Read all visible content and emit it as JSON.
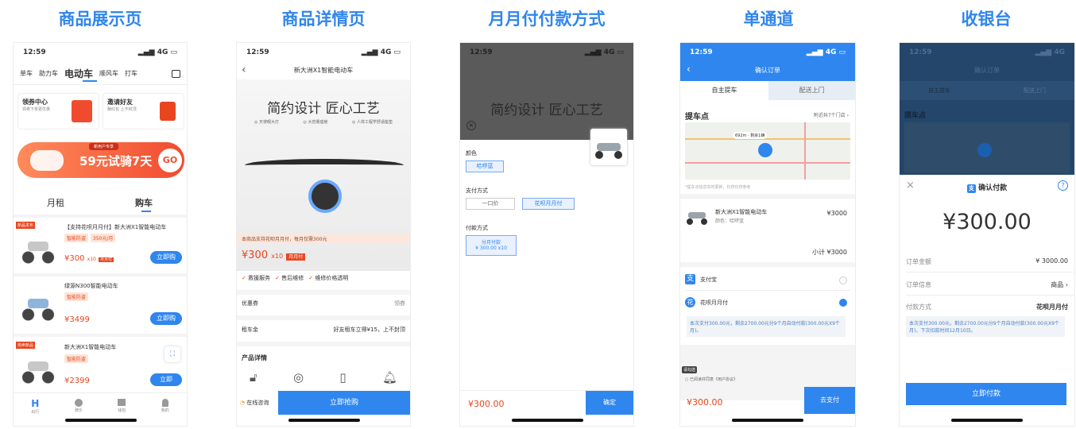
{
  "titles": [
    "商品展示页",
    "商品详情页",
    "月月付付款方式",
    "单通道",
    "收银台"
  ],
  "status": {
    "time": "12:59",
    "net": "4G"
  },
  "p1": {
    "tabs": [
      "单车",
      "助力车",
      "电动车",
      "顺风车",
      "打车"
    ],
    "cards": [
      {
        "title": "领券中心",
        "sub": "领券下单更优惠"
      },
      {
        "title": "邀请好友",
        "sub": "赚红包 上不封顶"
      }
    ],
    "banner": {
      "tag": "新用户专享",
      "text": "59元试骑7天",
      "go": "GO"
    },
    "subtabs": [
      "月租",
      "购车"
    ],
    "products": [
      {
        "badge": "新品发布",
        "name": "【支持花呗月月付】新大洲X1智能电动车",
        "tags": [
          "智能防盗",
          "350元/月"
        ],
        "price": "¥300",
        "suffix": "x10",
        "plan": "月月付",
        "btn": "立即购"
      },
      {
        "badge": "",
        "name": "绿源N300智能电动车",
        "tags": [
          "智能防盗"
        ],
        "price": "¥3499",
        "suffix": "",
        "plan": "",
        "btn": "立即购"
      },
      {
        "badge": "热卖新品",
        "name": "新大洲X1智能电动车",
        "tags": [
          "智能防盗"
        ],
        "price": "¥2399",
        "suffix": "",
        "plan": "",
        "btn": "立即"
      }
    ],
    "nav": [
      "出行",
      "骑乐",
      "钱包",
      "我的"
    ]
  },
  "p2": {
    "title": "新大洲X1智能电动车",
    "hero": "简约设计 匠心工艺",
    "features": [
      "天使眼大灯",
      "大容量座舱",
      "人体工程学舒适座垫"
    ],
    "promo": "本商品支持花呗月月付，每月仅需300元",
    "price": "¥300",
    "suffix": "x10",
    "plan": "月月付",
    "services": [
      "救援服务",
      "售后维修",
      "维修价格透明"
    ],
    "coupon_label": "优惠券",
    "coupon_val": "领券",
    "rent_label": "租车金",
    "rent_val": "好友租车立得¥15，上不封顶",
    "detail": "产品详情",
    "consult": "在线咨询",
    "buy": "立即抢购"
  },
  "p3": {
    "color_label": "颜色",
    "color": "哈啰蓝",
    "pay_label": "支付方式",
    "pay_opts": [
      "一口价",
      "花呗月月付"
    ],
    "plan_label": "付款方式",
    "plan_l1": "分月付款",
    "plan_l2": "¥ 300.00 x10",
    "total": "¥300.00",
    "confirm": "确定"
  },
  "p4": {
    "title": "确认订单",
    "tabs": [
      "自主提车",
      "配送上门"
    ],
    "pickup": "提车点",
    "nearby": "附近共7个门店",
    "map_label": "692m · 剩余1辆",
    "map_note": "*提车点信息实时更新，仅供仅供参考",
    "item": "新大洲X1智能电动车",
    "item_color": "颜色：哈啰蓝",
    "item_price": "¥3000",
    "subtotal": "小计 ¥3000",
    "alipay": "支付宝",
    "huabei": "花呗月月付",
    "note": "本次支付300.00元，剩余2700.00元分9个月自动付款(300.00元X9个月)。",
    "check_tip": "请勾选",
    "agree": "已阅读并同意《用户协议》",
    "total": "¥300.00",
    "pay": "去支付"
  },
  "p5": {
    "title": "确认付款",
    "amount": "¥300.00",
    "rows": [
      {
        "k": "订单金额",
        "v": "¥ 3000.00"
      },
      {
        "k": "订单信息",
        "v": "商品"
      },
      {
        "k": "付款方式",
        "v": "花呗月月付"
      }
    ],
    "note": "本次支付300.00元，剩余2700.00元分9个月自动付款(300.00元X9个月)，下次扣款时间12月10日。",
    "btn": "立即付款"
  },
  "colors": {
    "brand": "#2f86ee",
    "accent": "#e8461f"
  }
}
